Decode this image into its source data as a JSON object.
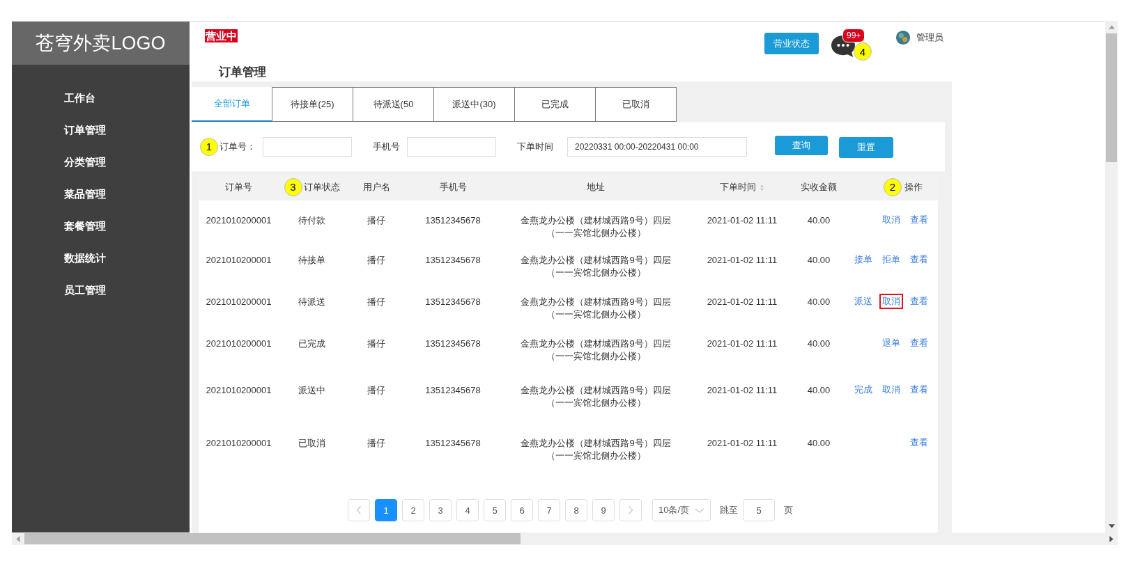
{
  "sidebar": {
    "logo": "苍穹外卖LOGO",
    "items": [
      {
        "label": "工作台"
      },
      {
        "label": "订单管理"
      },
      {
        "label": "分类管理"
      },
      {
        "label": "菜品管理"
      },
      {
        "label": "套餐管理"
      },
      {
        "label": "数据统计"
      },
      {
        "label": "员工管理"
      }
    ]
  },
  "header": {
    "status_badge": "营业中",
    "page_title": "订单管理",
    "status_button": "营业状态",
    "messages": {
      "badge": "99+",
      "marker": "4"
    },
    "user": "管理员"
  },
  "tabs": [
    {
      "label": "全部订单",
      "selected": true
    },
    {
      "label": "待接单(25)",
      "selected": false
    },
    {
      "label": "待派送(50",
      "selected": false
    },
    {
      "label": "派送中(30)",
      "selected": false
    },
    {
      "label": "已完成",
      "selected": false
    },
    {
      "label": "已取消",
      "selected": false
    }
  ],
  "filters": {
    "fields": [
      {
        "label": "订单号：",
        "marker": "1"
      },
      {
        "label": "手机号"
      },
      {
        "label": "下单时间",
        "value": "20220331 00:00-20220431 00:00"
      }
    ],
    "buttons": [
      "查询",
      "重置"
    ]
  },
  "table": {
    "columns": [
      {
        "label": "订单号"
      },
      {
        "label": "订单状态",
        "marker": "3"
      },
      {
        "label": "用户名"
      },
      {
        "label": "手机号"
      },
      {
        "label": "地址"
      },
      {
        "label": "下单时间",
        "sortable": true
      },
      {
        "label": "实收金额"
      },
      {
        "label": "操作",
        "marker": "2"
      }
    ],
    "rows": [
      {
        "cells": [
          "2021010200001",
          "待付款",
          "播仔",
          "13512345678",
          "金燕龙办公楼（建材城西路9号）四层（一一宾馆北侧办公楼）",
          "2021-01-02 11:11",
          "40.00"
        ],
        "actions": [
          {
            "label": "取消",
            "highlighted": false
          },
          {
            "label": "查看",
            "highlighted": false
          }
        ]
      },
      {
        "cells": [
          "2021010200001",
          "待接单",
          "播仔",
          "13512345678",
          "金燕龙办公楼（建材城西路9号）四层（一一宾馆北侧办公楼）",
          "2021-01-02 11:11",
          "40.00"
        ],
        "actions": [
          {
            "label": "接单",
            "highlighted": false
          },
          {
            "label": "拒单",
            "highlighted": false
          },
          {
            "label": "查看",
            "highlighted": false
          }
        ]
      },
      {
        "cells": [
          "2021010200001",
          "待派送",
          "播仔",
          "13512345678",
          "金燕龙办公楼（建材城西路9号）四层（一一宾馆北侧办公楼）",
          "2021-01-02 11:11",
          "40.00"
        ],
        "actions": [
          {
            "label": "派送",
            "highlighted": false
          },
          {
            "label": "取消",
            "highlighted": true
          },
          {
            "label": "查看",
            "highlighted": false
          }
        ]
      },
      {
        "cells": [
          "2021010200001",
          "已完成",
          "播仔",
          "13512345678",
          "金燕龙办公楼（建材城西路9号）四层（一一宾馆北侧办公楼）",
          "2021-01-02 11:11",
          "40.00"
        ],
        "actions": [
          {
            "label": "退单",
            "highlighted": false
          },
          {
            "label": "查看",
            "highlighted": false
          }
        ]
      },
      {
        "cells": [
          "2021010200001",
          "派送中",
          "播仔",
          "13512345678",
          "金燕龙办公楼（建材城西路9号）四层（一一宾馆北侧办公楼）",
          "2021-01-02 11:11",
          "40.00"
        ],
        "actions": [
          {
            "label": "完成",
            "highlighted": false
          },
          {
            "label": "取消",
            "highlighted": false
          },
          {
            "label": "查看",
            "highlighted": false
          }
        ]
      },
      {
        "cells": [
          "2021010200001",
          "已取消",
          "播仔",
          "13512345678",
          "金燕龙办公楼（建材城西路9号）四层（一一宾馆北侧办公楼）",
          "2021-01-02 11:11",
          "40.00"
        ],
        "actions": [
          {
            "label": "查看",
            "highlighted": false
          }
        ]
      }
    ]
  },
  "pagination": {
    "pages": [
      {
        "label": "1",
        "selected": true
      },
      {
        "label": "2",
        "selected": false
      },
      {
        "label": "3",
        "selected": false
      },
      {
        "label": "4",
        "selected": false
      },
      {
        "label": "5",
        "selected": false
      },
      {
        "label": "6",
        "selected": false
      },
      {
        "label": "7",
        "selected": false
      },
      {
        "label": "8",
        "selected": false
      },
      {
        "label": "9",
        "selected": false
      }
    ],
    "page_size": "10条/页",
    "jump_label": "跳至",
    "jump_value": "5",
    "page_unit": "页"
  }
}
